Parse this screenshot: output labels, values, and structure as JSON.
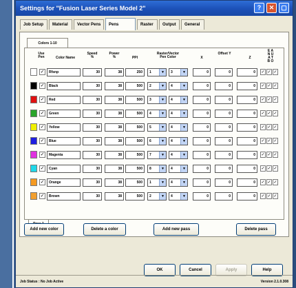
{
  "window": {
    "title": "Settings for \"Fusion Laser Series Model 2\""
  },
  "tabs": [
    "Job Setup",
    "Material",
    "Vector Pens",
    "Pens",
    "Raster",
    "Output",
    "General"
  ],
  "active_tab": "Pens",
  "subtab": "Colors 1-10",
  "columns": {
    "use": "Use\nPen",
    "name": "Color Name",
    "speed": "Speed\n%",
    "power": "Power\n%",
    "ppi": "PPI",
    "raster_vector": "Raster/Vector\nPen   Color",
    "x": "X",
    "offset": "Offset Y",
    "y": "Y",
    "z": "Z",
    "mode": "E  A\nN  U\nA  T\nB  O"
  },
  "rows": [
    {
      "swatch": "#ffffff",
      "use": "✓",
      "name": "Rfsnp",
      "speed": "30",
      "power": "38",
      "ppi": "250",
      "pen": "1",
      "color": "3",
      "x": "0",
      "y": "0",
      "z": "0",
      "m": [
        "✓",
        "✓",
        "✓"
      ]
    },
    {
      "swatch": "#000000",
      "use": "✓",
      "name": "Black",
      "speed": "30",
      "power": "38",
      "ppi": "500",
      "pen": "2",
      "color": "4",
      "x": "0",
      "y": "0",
      "z": "0",
      "m": [
        "✓",
        "✓",
        "✓"
      ]
    },
    {
      "swatch": "#e01010",
      "use": "✓",
      "name": "Red",
      "speed": "30",
      "power": "38",
      "ppi": "500",
      "pen": "3",
      "color": "4",
      "x": "0",
      "y": "0",
      "z": "0",
      "m": [
        "✓",
        "✓",
        "✓"
      ]
    },
    {
      "swatch": "#2aa52a",
      "use": "✓",
      "name": "Green",
      "speed": "30",
      "power": "38",
      "ppi": "500",
      "pen": "4",
      "color": "4",
      "x": "0",
      "y": "0",
      "z": "0",
      "m": [
        "✓",
        "✓",
        "✓"
      ]
    },
    {
      "swatch": "#f0f000",
      "use": "✓",
      "name": "Yellow",
      "speed": "30",
      "power": "38",
      "ppi": "500",
      "pen": "5",
      "color": "4",
      "x": "0",
      "y": "0",
      "z": "0",
      "m": [
        "✓",
        "✓",
        "✓"
      ]
    },
    {
      "swatch": "#1f1fe0",
      "use": "✓",
      "name": "Blue",
      "speed": "30",
      "power": "38",
      "ppi": "500",
      "pen": "6",
      "color": "4",
      "x": "0",
      "y": "0",
      "z": "0",
      "m": [
        "✓",
        "✓",
        "✓"
      ]
    },
    {
      "swatch": "#e030e0",
      "use": "✓",
      "name": "Magenta",
      "speed": "30",
      "power": "38",
      "ppi": "500",
      "pen": "7",
      "color": "4",
      "x": "0",
      "y": "0",
      "z": "0",
      "m": [
        "✓",
        "✓",
        "✓"
      ]
    },
    {
      "swatch": "#20d8e8",
      "use": "✓",
      "name": "Cyan",
      "speed": "30",
      "power": "38",
      "ppi": "500",
      "pen": "8",
      "color": "4",
      "x": "0",
      "y": "0",
      "z": "0",
      "m": [
        "✓",
        "✓",
        "✓"
      ]
    },
    {
      "swatch": "#f59a20",
      "use": "✓",
      "name": "Orange",
      "speed": "30",
      "power": "38",
      "ppi": "500",
      "pen": "1",
      "color": "4",
      "x": "0",
      "y": "0",
      "z": "0",
      "m": [
        "✓",
        "✓",
        "✓"
      ]
    },
    {
      "swatch": "#f2a030",
      "use": "✓",
      "name": "Brown",
      "speed": "30",
      "power": "38",
      "ppi": "500",
      "pen": "2",
      "color": "4",
      "x": "0",
      "y": "0",
      "z": "0",
      "m": [
        "✓",
        "✓",
        "✓"
      ]
    }
  ],
  "pass_tab": "Pass 1",
  "actions": {
    "add": "Add new color",
    "delete": "Delete a color",
    "add_pass": "Add new pass",
    "delete_pass": "Delete pass"
  },
  "dialog": {
    "ok": "OK",
    "cancel": "Cancel",
    "apply": "Apply",
    "help": "Help"
  },
  "status": {
    "left": "Job Status : No Job Active",
    "right": "Version 2.1.0.308"
  }
}
